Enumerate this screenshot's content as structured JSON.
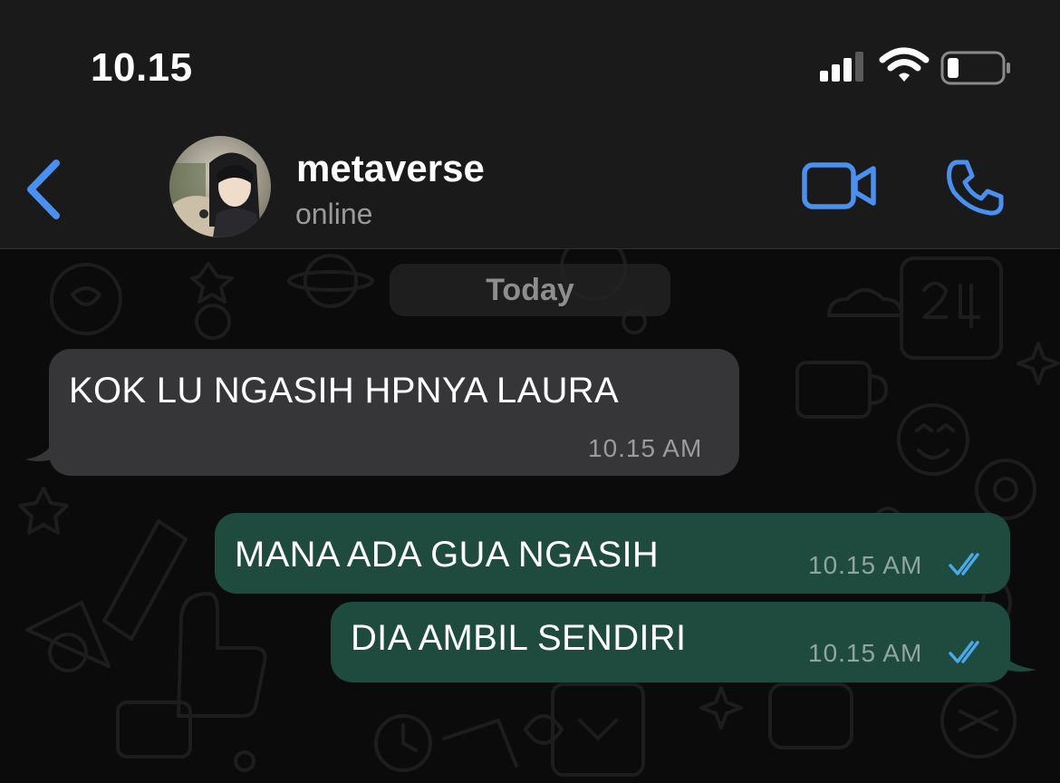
{
  "status_bar": {
    "time": "10.15",
    "icons": [
      "cellular-signal-icon",
      "wifi-icon",
      "battery-icon"
    ]
  },
  "header": {
    "contact_name": "metaverse",
    "contact_status": "online",
    "icons": [
      "back-chevron-icon",
      "video-camera-icon",
      "phone-icon"
    ]
  },
  "chat": {
    "date_label": "Today",
    "messages": [
      {
        "direction": "incoming",
        "text": "KOK LU NGASIH HPNYA LAURA",
        "time": "10.15 AM"
      },
      {
        "direction": "outgoing",
        "text": "MANA ADA GUA NGASIH",
        "time": "10.15 AM",
        "status": "read"
      },
      {
        "direction": "outgoing",
        "text": "DIA AMBIL SENDIRI",
        "time": "10.15 AM",
        "status": "read"
      }
    ]
  },
  "colors": {
    "accent": "#4a90f0",
    "incoming_bubble": "#363638",
    "outgoing_bubble": "#1f4a3e",
    "read_ticks": "#4aa8e8",
    "header_bg": "#1a1a1a"
  }
}
